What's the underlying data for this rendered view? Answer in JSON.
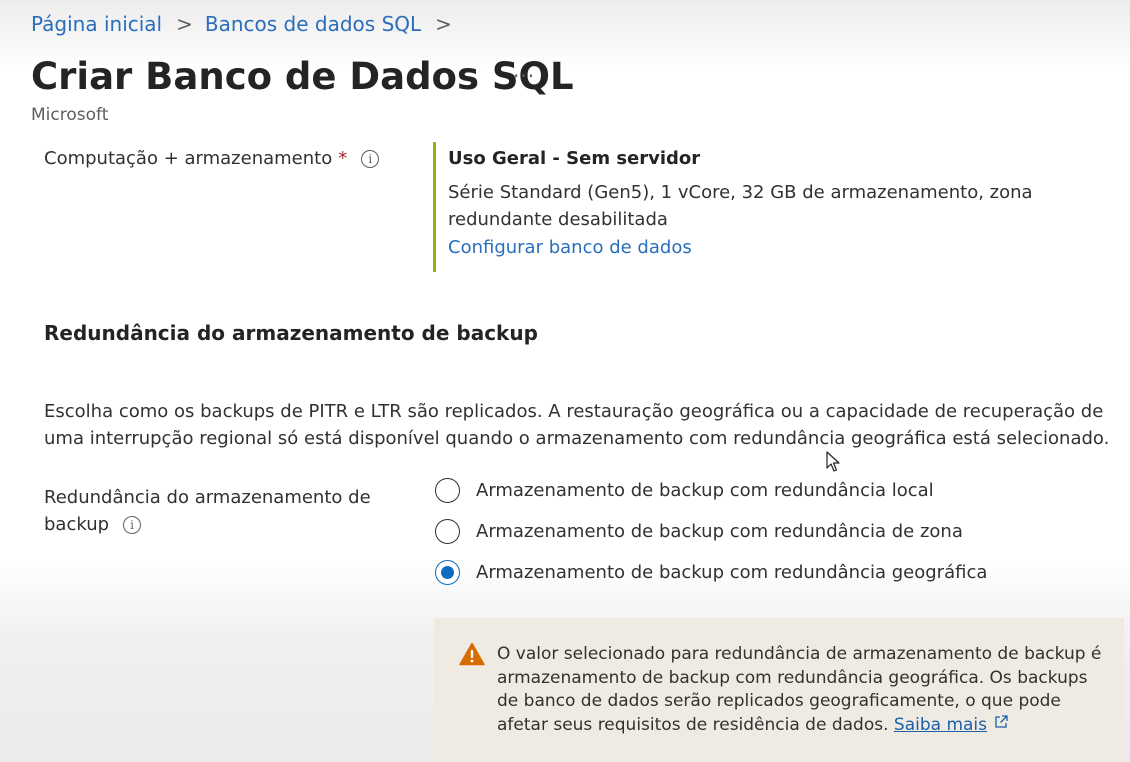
{
  "breadcrumb": {
    "items": [
      "Página inicial",
      "Bancos de dados SQL"
    ],
    "separator": ">"
  },
  "page": {
    "title": "Criar Banco de Dados SQL",
    "more_icon": "ellipsis-icon",
    "subtitle": "Microsoft"
  },
  "compute": {
    "label": "Computação + armazenamento",
    "required_mark": "*",
    "info_icon": "info-icon",
    "tier_title": "Uso Geral - Sem servidor",
    "description": "Série Standard (Gen5), 1 vCore, 32 GB de armazenamento, zona redundante desabilitada",
    "configure_link": "Configurar banco de dados",
    "accent_color": "#8db600"
  },
  "backup": {
    "section_title": "Redundância do armazenamento de backup",
    "description": "Escolha como os backups de PITR e LTR são replicados. A restauração geográfica ou a capacidade de recuperação de uma interrupção regional só está disponível quando o armazenamento com redundância geográfica está selecionado.",
    "field_label": "Redundância do armazenamento de backup",
    "options": [
      {
        "label": "Armazenamento de backup com redundância local",
        "selected": false
      },
      {
        "label": "Armazenamento de backup com redundância de zona",
        "selected": false
      },
      {
        "label": "Armazenamento de backup com redundância geográfica",
        "selected": true
      }
    ],
    "selected_color": "#0f6cbd"
  },
  "warning": {
    "icon": "warning-icon",
    "text": "O valor selecionado para redundância de armazenamento de backup é armazenamento de backup com redundância geográfica. Os backups de banco de dados serão replicados geograficamente, o que pode afetar seus requisitos de residência de dados.",
    "link": "Saiba mais",
    "link_icon": "external-link-icon",
    "icon_color": "#d66b00"
  }
}
